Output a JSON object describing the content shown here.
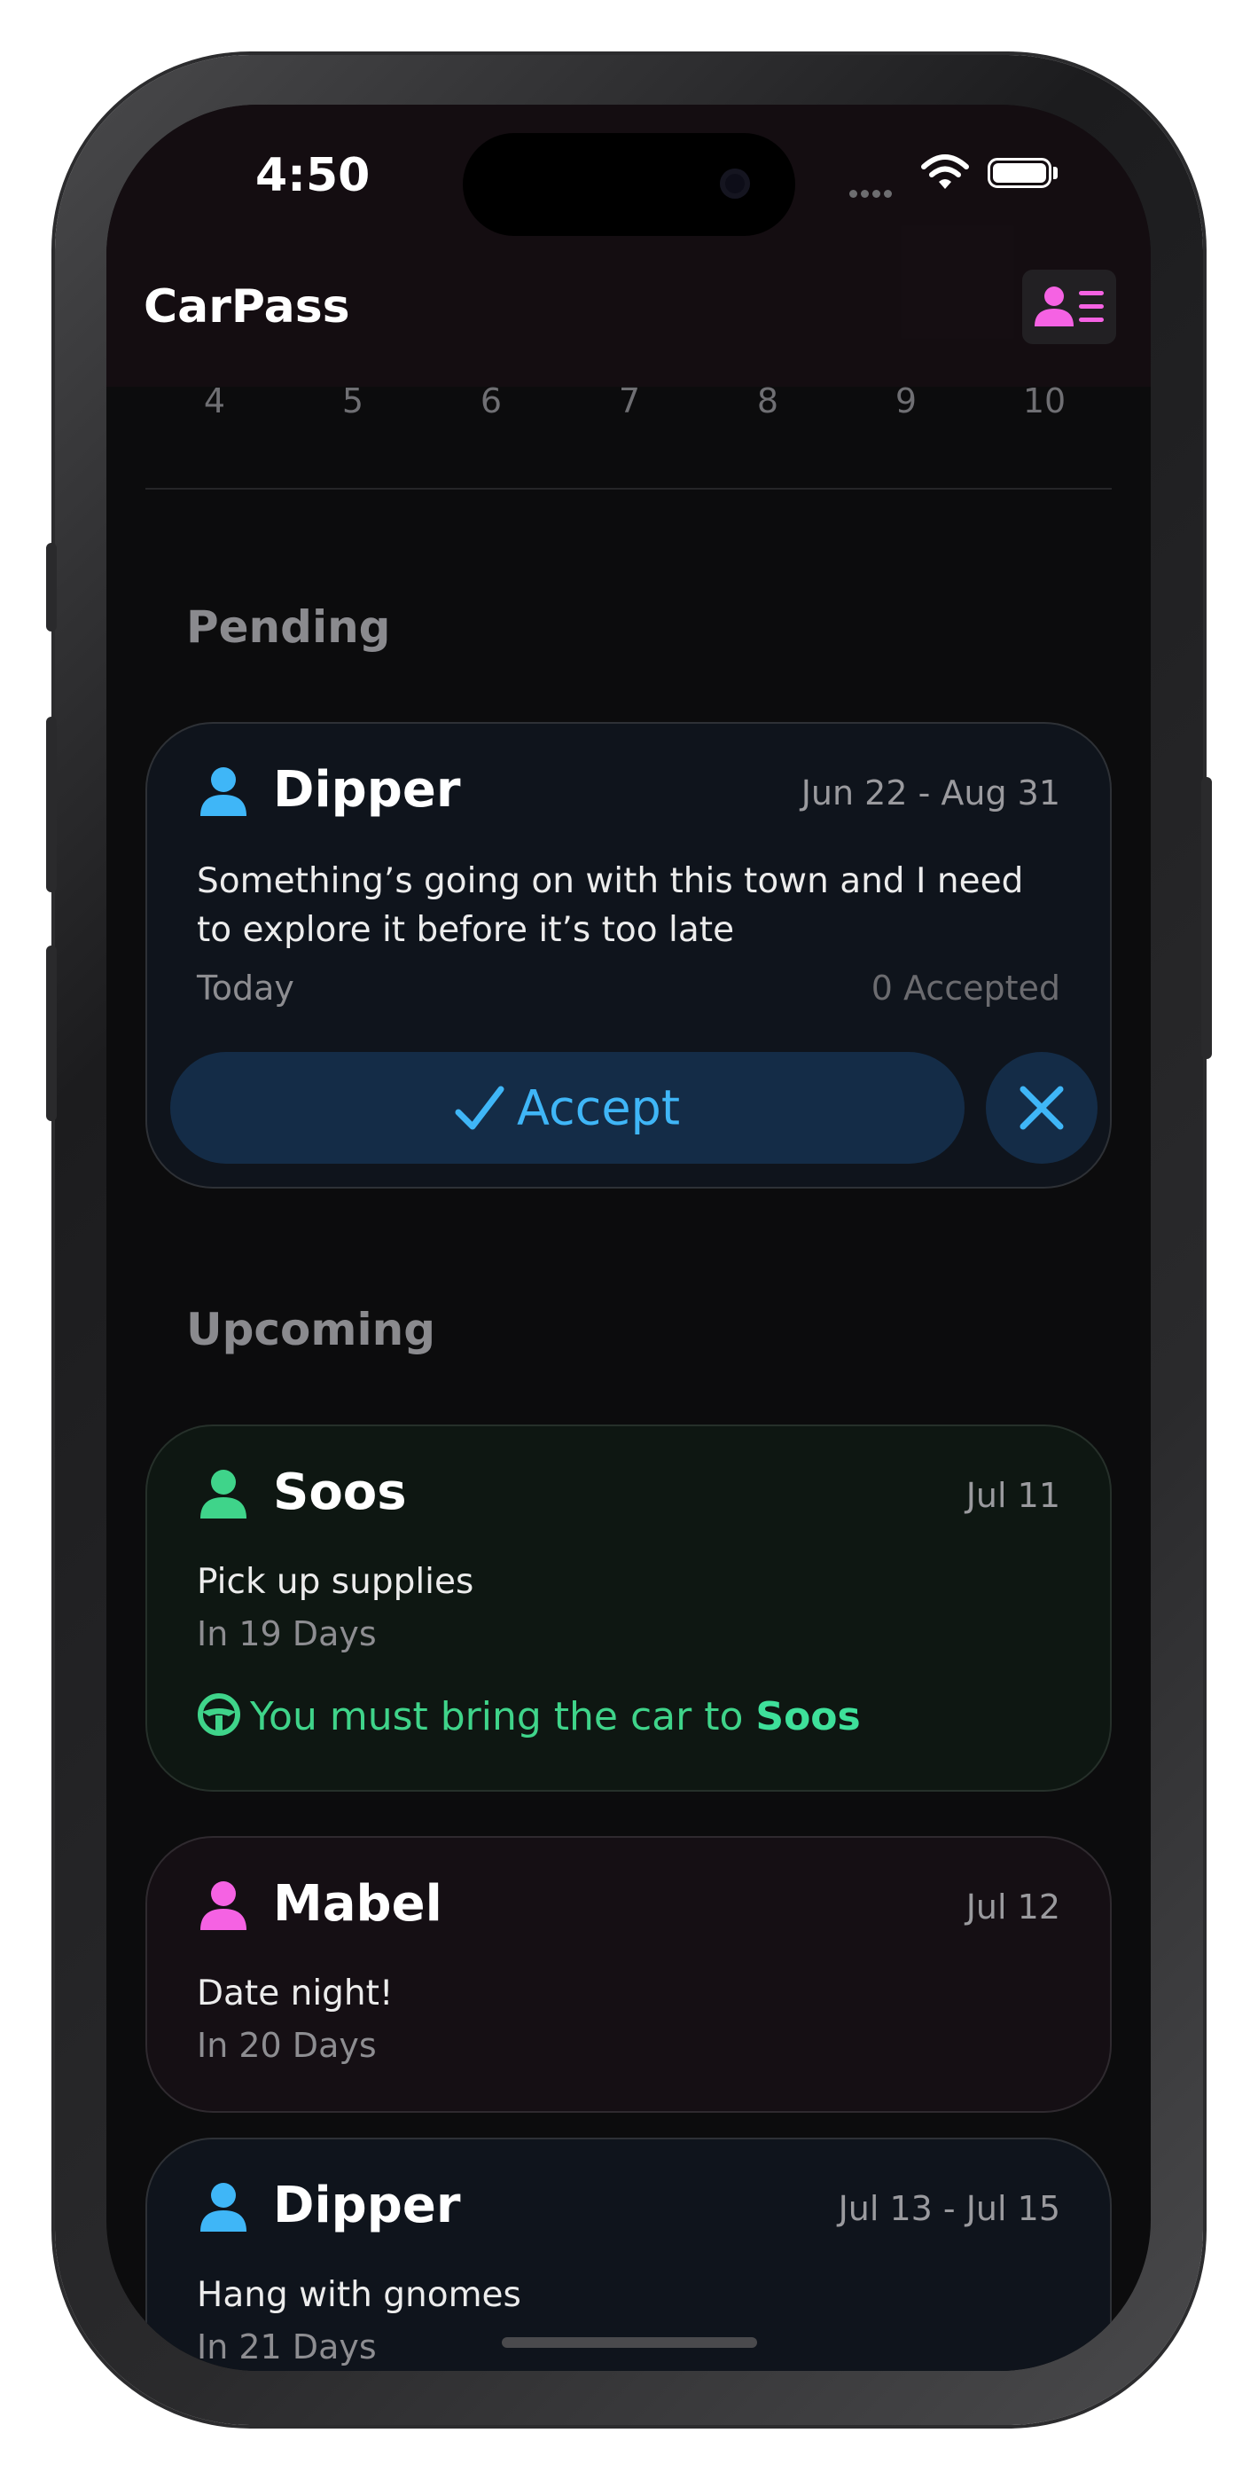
{
  "status_bar": {
    "time": "4:50"
  },
  "header": {
    "title": "CarPass",
    "profile_icon": "person-list-icon",
    "accent": "#f562e3"
  },
  "calendar": {
    "days": [
      "4",
      "5",
      "6",
      "7",
      "8",
      "9",
      "10"
    ]
  },
  "pending": {
    "title": "Pending",
    "card": {
      "name": "Dipper",
      "date_range": "Jun 22 - Aug 31",
      "description": "Something’s going on with this town and I need to explore it before it’s too late",
      "when": "Today",
      "accepted": "0 Accepted",
      "accept_label": "Accept",
      "color": "#3fb6f7"
    }
  },
  "upcoming": {
    "title": "Upcoming",
    "cards": [
      {
        "name": "Soos",
        "date": "Jul 11",
        "description": "Pick up supplies",
        "when": "In 19 Days",
        "car_prefix": "You must bring the car to ",
        "car_target": "Soos",
        "color": "#3fd48a"
      },
      {
        "name": "Mabel",
        "date": "Jul 12",
        "description": "Date night!",
        "when": "In 20 Days",
        "color": "#f562e3"
      },
      {
        "name": "Dipper",
        "date": "Jul 13 - Jul 15",
        "description": "Hang with gnomes",
        "when": "In 21 Days",
        "color": "#3fb6f7"
      }
    ]
  }
}
